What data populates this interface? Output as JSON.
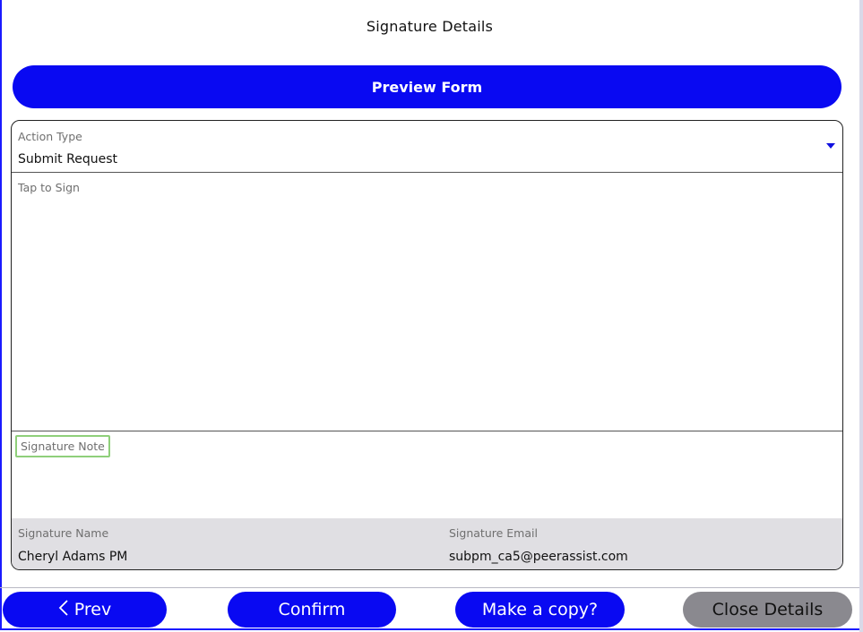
{
  "header": {
    "title": "Signature Details"
  },
  "preview": {
    "label": "Preview Form"
  },
  "action_type": {
    "label": "Action Type",
    "value": "Submit Request"
  },
  "signature_pad": {
    "label": "Tap to Sign"
  },
  "signature_note": {
    "label": "Signature Note",
    "value": ""
  },
  "signer": {
    "name_label": "Signature Name",
    "name_value": "Cheryl Adams PM",
    "email_label": "Signature Email",
    "email_value": "subpm_ca5@peerassist.com"
  },
  "footer": {
    "prev_label": "Prev",
    "confirm_label": "Confirm",
    "copy_label": "Make a copy?",
    "close_label": "Close Details"
  },
  "colors": {
    "accent": "#0909f2",
    "highlight": "#8fcf7a",
    "info_bg": "#e0dfe3",
    "disabled": "#8a898f"
  }
}
